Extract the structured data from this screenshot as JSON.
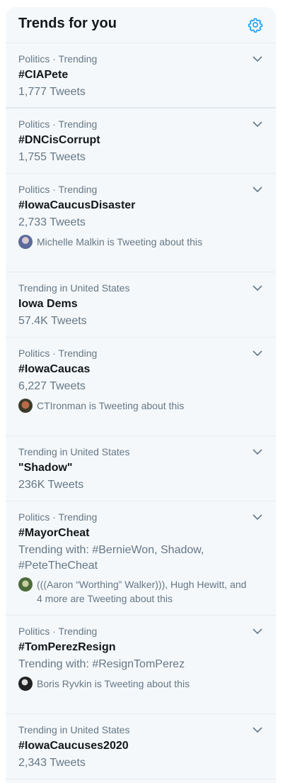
{
  "header": {
    "title": "Trends for you"
  },
  "trends": [
    {
      "context": "Politics · Trending",
      "name": "#CIAPete",
      "meta": "1,777 Tweets"
    },
    {
      "context": "Politics · Trending",
      "name": "#DNCisCorrupt",
      "meta": "1,755 Tweets"
    },
    {
      "context": "Politics · Trending",
      "name": "#IowaCaucusDisaster",
      "meta": "2,733 Tweets",
      "tweeting": "Michelle Malkin is Tweeting about this"
    },
    {
      "context": "Trending in United States",
      "name": "Iowa Dems",
      "meta": "57.4K Tweets"
    },
    {
      "context": "Politics · Trending",
      "name": "#IowaCaucas",
      "meta": "6,227 Tweets",
      "tweeting": "CTIronman is Tweeting about this"
    },
    {
      "context": "Trending in United States",
      "name": "\"Shadow\"",
      "meta": "236K Tweets"
    },
    {
      "context": "Politics · Trending",
      "name": "#MayorCheat",
      "meta": "Trending with: #BernieWon, Shadow, #PeteTheCheat",
      "tweeting": "(((Aaron “Worthing” Walker))), Hugh Hewitt, and 4 more are Tweeting about this"
    },
    {
      "context": "Politics · Trending",
      "name": "#TomPerezResign",
      "meta": "Trending with: #ResignTomPerez",
      "tweeting": "Boris Ryvkin is Tweeting about this"
    },
    {
      "context": "Trending in United States",
      "name": "#IowaCaucuses2020",
      "meta": "2,343 Tweets"
    }
  ],
  "colors": {
    "accent": "#1da1f2",
    "secondary_text": "#657786",
    "primary_text": "#14171a",
    "panel_bg": "#f5f8fa"
  }
}
